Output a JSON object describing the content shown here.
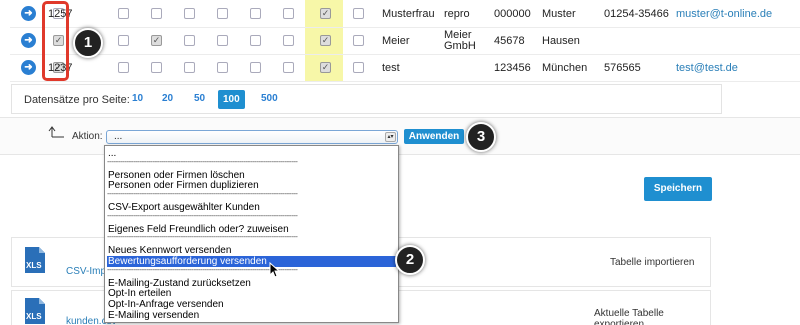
{
  "rows": [
    {
      "num": "1257",
      "name": "Musterfrau",
      "col2": "repro",
      "zip": "000000",
      "city": "Muster",
      "phone": "01254-35466",
      "email": "muster@t-online.de",
      "checked_first": false,
      "checked_extra": false
    },
    {
      "num": "",
      "name": "Meier",
      "col2": "Meier GmbH",
      "zip": "45678",
      "city": "Hausen",
      "phone": "",
      "email": "",
      "checked_first": true,
      "checked_extra": true
    },
    {
      "num": "1237",
      "name": "test",
      "col2": "",
      "zip": "123456",
      "city": "München",
      "phone": "576565",
      "email": "test@test.de",
      "checked_first": true,
      "checked_extra": false
    }
  ],
  "pager": {
    "label": "Datensätze pro Seite:",
    "options": [
      "10",
      "20",
      "50",
      "100",
      "500"
    ],
    "active": "100"
  },
  "action": {
    "label": "Aktion:",
    "selected_value": "...",
    "apply_label": "Anwenden"
  },
  "dropdown": {
    "items": [
      {
        "label": "...",
        "type": "item"
      },
      {
        "label": "----------------------------------------------------------------------------------------",
        "type": "sep"
      },
      {
        "label": "Personen oder Firmen löschen",
        "type": "item"
      },
      {
        "label": "Personen oder Firmen duplizieren",
        "type": "item"
      },
      {
        "label": "----------------------------------------------------------------------------------------",
        "type": "sep"
      },
      {
        "label": "CSV-Export ausgewählter Kunden",
        "type": "item"
      },
      {
        "label": "----------------------------------------------------------------------------------------",
        "type": "sep"
      },
      {
        "label": "Eigenes Feld Freundlich oder? zuweisen",
        "type": "item"
      },
      {
        "label": "----------------------------------------------------------------------------------------",
        "type": "sep"
      },
      {
        "label": "Neues Kennwort versenden",
        "type": "item"
      },
      {
        "label": "Bewertungsaufforderung versenden",
        "type": "selected"
      },
      {
        "label": "----------------------------------------------------------------------------------------",
        "type": "sep"
      },
      {
        "label": "E-Mailing-Zustand zurücksetzen",
        "type": "item"
      },
      {
        "label": "Opt-In erteilen",
        "type": "item"
      },
      {
        "label": "Opt-In-Anfrage versenden",
        "type": "item"
      },
      {
        "label": "E-Mailing versenden",
        "type": "item"
      }
    ]
  },
  "save_label": "Speichern",
  "import": {
    "link": "CSV-Impo",
    "title": "Tabelle importieren"
  },
  "export": {
    "link": "kunden.csv",
    "title": "Aktuelle Tabelle exportieren"
  },
  "file_icon_label": "XLS",
  "badges": [
    "1",
    "2",
    "3"
  ],
  "colors": {
    "accent": "#1f8fd0",
    "highlight": "#f7f7a8",
    "annotation": "#e0392b",
    "selected": "#2b64d8"
  },
  "icons": {
    "row_arrow": "arrow-right-circle-icon",
    "sort": "return-arrow-icon",
    "cursor": "mouse-pointer-icon"
  }
}
